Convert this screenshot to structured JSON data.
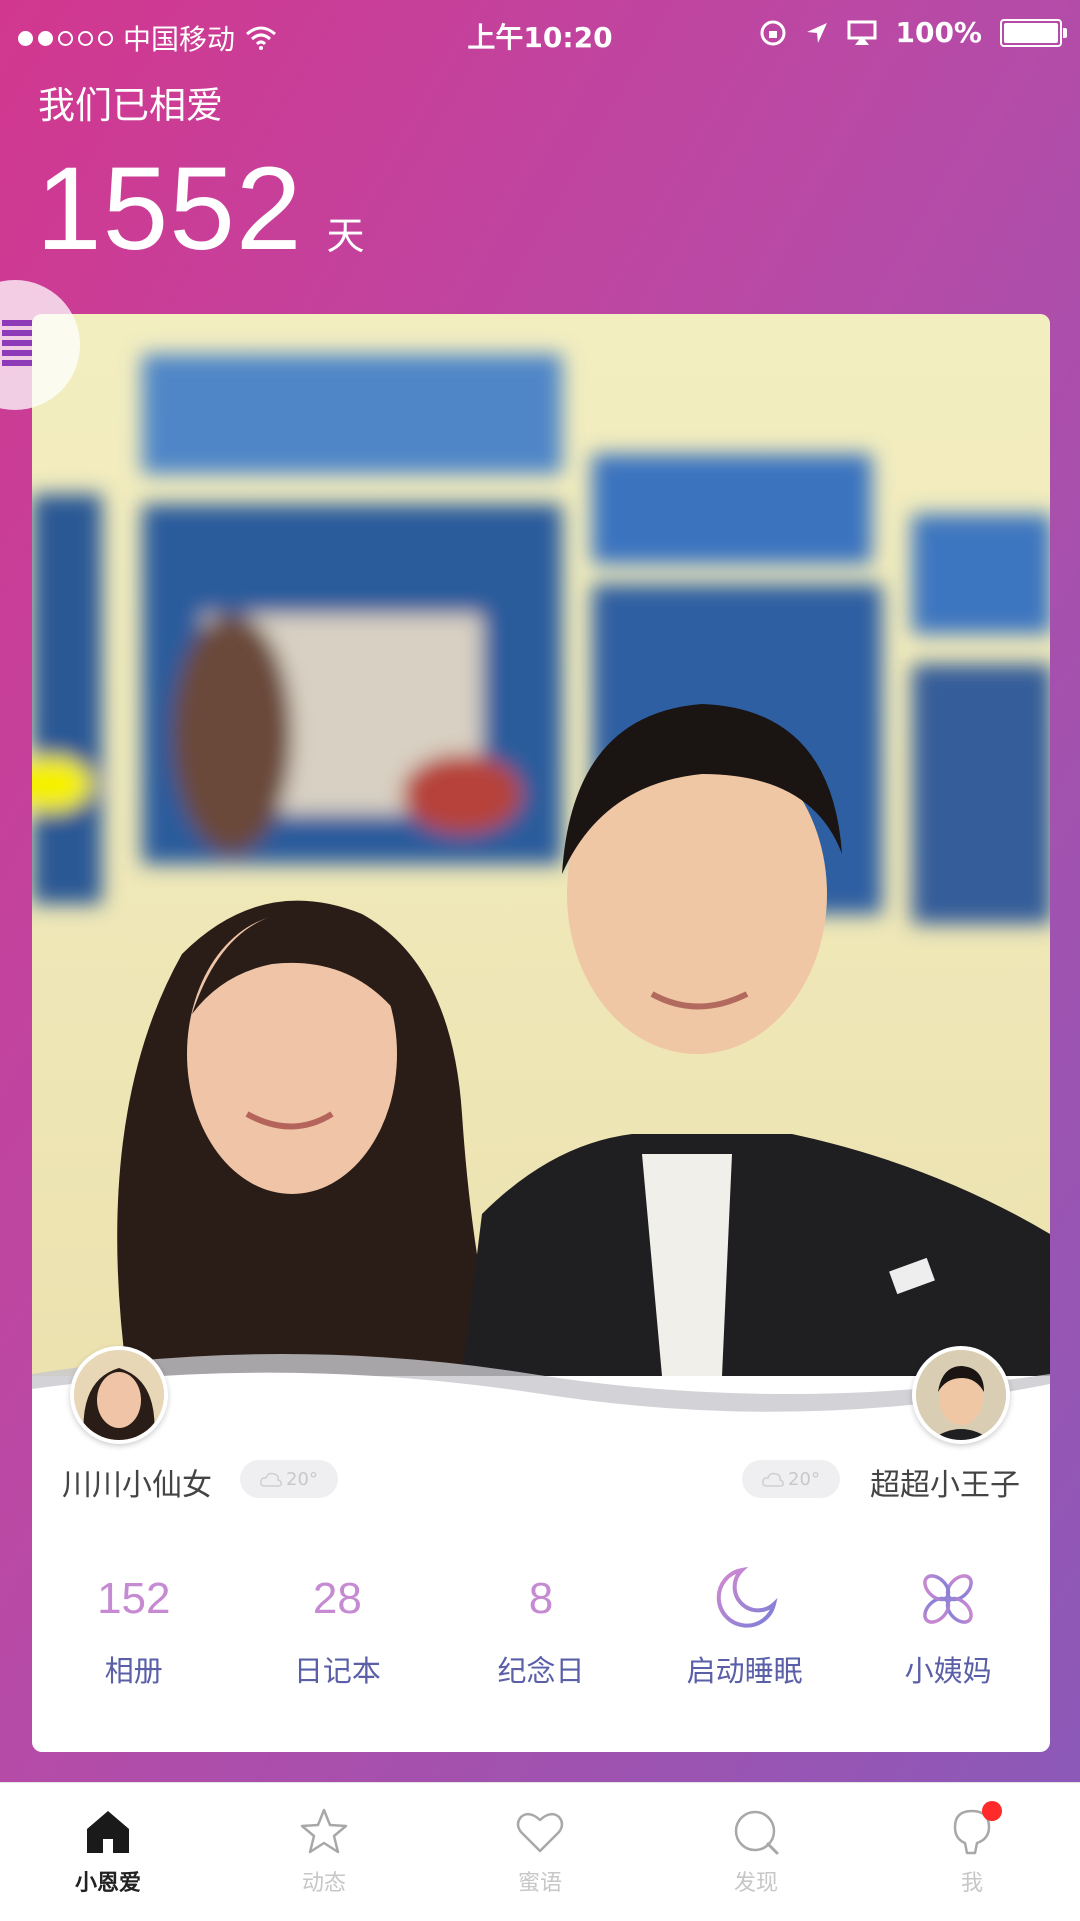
{
  "status_bar": {
    "carrier": "中国移动",
    "time": "上午10:20",
    "battery_percent": "100%",
    "battery_level": 1.0,
    "signal_bars_filled": 2,
    "signal_bars_total": 5
  },
  "header": {
    "label": "我们已相爱",
    "days_count": "1552",
    "days_unit": "天"
  },
  "couple": {
    "left": {
      "name": "川川小仙女",
      "weather": "20°"
    },
    "right": {
      "name": "超超小王子",
      "weather": "20°"
    }
  },
  "stats": [
    {
      "value": "152",
      "label": "相册"
    },
    {
      "value": "28",
      "label": "日记本"
    },
    {
      "value": "8",
      "label": "纪念日"
    },
    {
      "icon": "moon-icon",
      "label": "启动睡眠"
    },
    {
      "icon": "flower-icon",
      "label": "小姨妈"
    }
  ],
  "tabs": [
    {
      "label": "小恩爱",
      "icon": "home-icon",
      "active": true
    },
    {
      "label": "动态",
      "icon": "star-icon",
      "active": false
    },
    {
      "label": "蜜语",
      "icon": "heart-icon",
      "active": false
    },
    {
      "label": "发现",
      "icon": "search-icon",
      "active": false
    },
    {
      "label": "我",
      "icon": "profile-icon",
      "active": false,
      "badge": true
    }
  ],
  "colors": {
    "gradient_start": "#d2378f",
    "gradient_end": "#8c59b8",
    "stat_value": "#c58ad2",
    "stat_label": "#5a5fa8",
    "badge": "#ff2a2a"
  }
}
